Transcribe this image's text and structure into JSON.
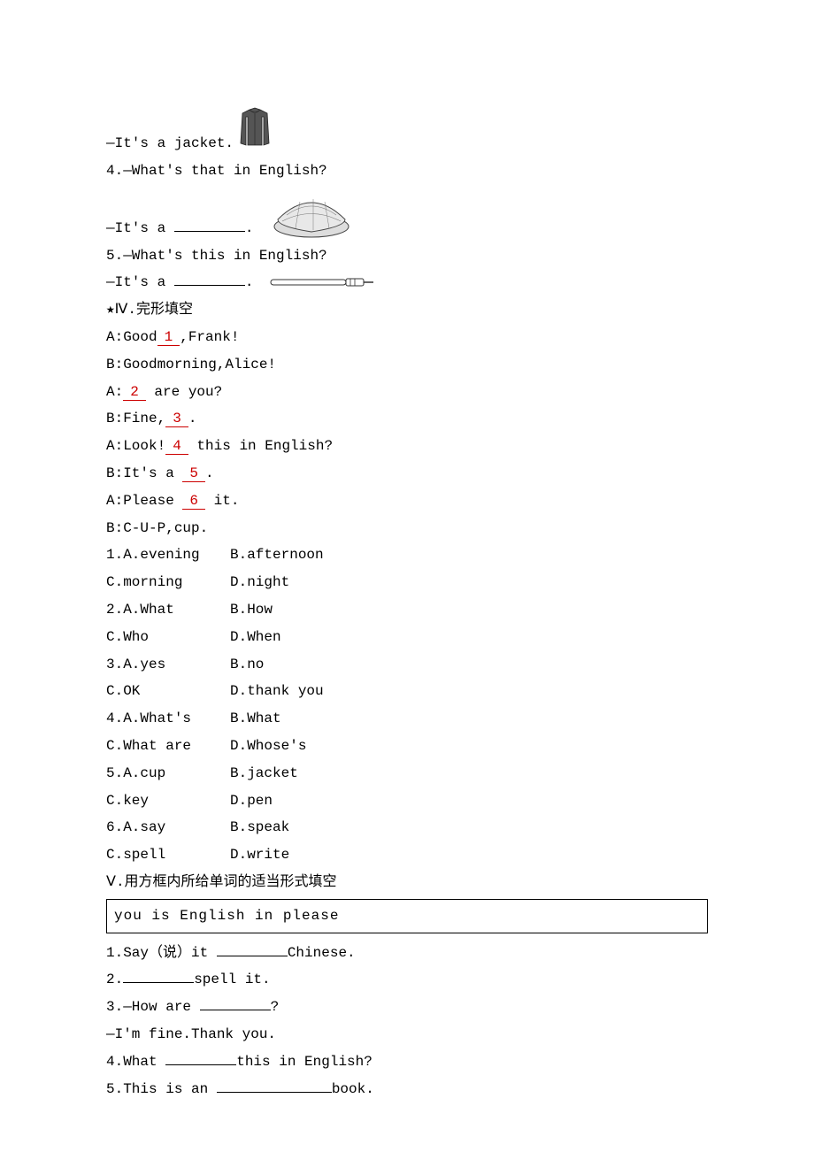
{
  "q3": {
    "answer_prefix": "—It's a jacket."
  },
  "q4": {
    "prompt": "4.—What's that in English?",
    "answer_prefix": "—It's a ",
    "answer_suffix": "."
  },
  "q5": {
    "prompt": "5.—What's this in English?",
    "answer_prefix": "—It's a ",
    "answer_suffix": "."
  },
  "section4_title": "★Ⅳ.完形填空",
  "cloze_dialog": {
    "l1a": "A:Good",
    "l1b": ",Frank!",
    "l2": "B:Goodmorning,Alice!",
    "l3a": "A:",
    "l3b": " are you?",
    "l4a": "B:Fine,",
    "l4b": ".",
    "l5a": "A:Look!",
    "l5b": " this in English?",
    "l6a": "B:It's a ",
    "l6b": ".",
    "l7a": "A:Please ",
    "l7b": " it.",
    "l8": "B:C-U-P,cup."
  },
  "nums": [
    "1",
    "2",
    "3",
    "4",
    "5",
    "6"
  ],
  "options": [
    {
      "row1a": "1.A.evening",
      "row1b": "B.afternoon",
      "row2a": "C.morning",
      "row2b": "D.night"
    },
    {
      "row1a": "2.A.What",
      "row1b": "B.How",
      "row2a": "C.Who",
      "row2b": "D.When"
    },
    {
      "row1a": "3.A.yes",
      "row1b": "B.no",
      "row2a": "C.OK",
      "row2b": "D.thank you"
    },
    {
      "row1a": "4.A.What's",
      "row1b": "B.What",
      "row2a": "C.What are",
      "row2b": "D.Whose's"
    },
    {
      "row1a": "5.A.cup",
      "row1b": "B.jacket",
      "row2a": "C.key",
      "row2b": "D.pen"
    },
    {
      "row1a": "6.A.say",
      "row1b": "B.speak",
      "row2a": "C.spell",
      "row2b": "D.write"
    }
  ],
  "section5_title": "Ⅴ.用方框内所给单词的适当形式填空",
  "word_box": "you  is  English  in  please",
  "fill": {
    "q1a": "1.Say（说）it ",
    "q1b": "Chinese.",
    "q2a": "2.",
    "q2b": "spell it.",
    "q3a": "3.—How are ",
    "q3b": "?",
    "q3ans": "—I'm fine.Thank you.",
    "q4a": "4.What ",
    "q4b": "this in English?",
    "q5a": "5.This is an ",
    "q5b": "book."
  }
}
